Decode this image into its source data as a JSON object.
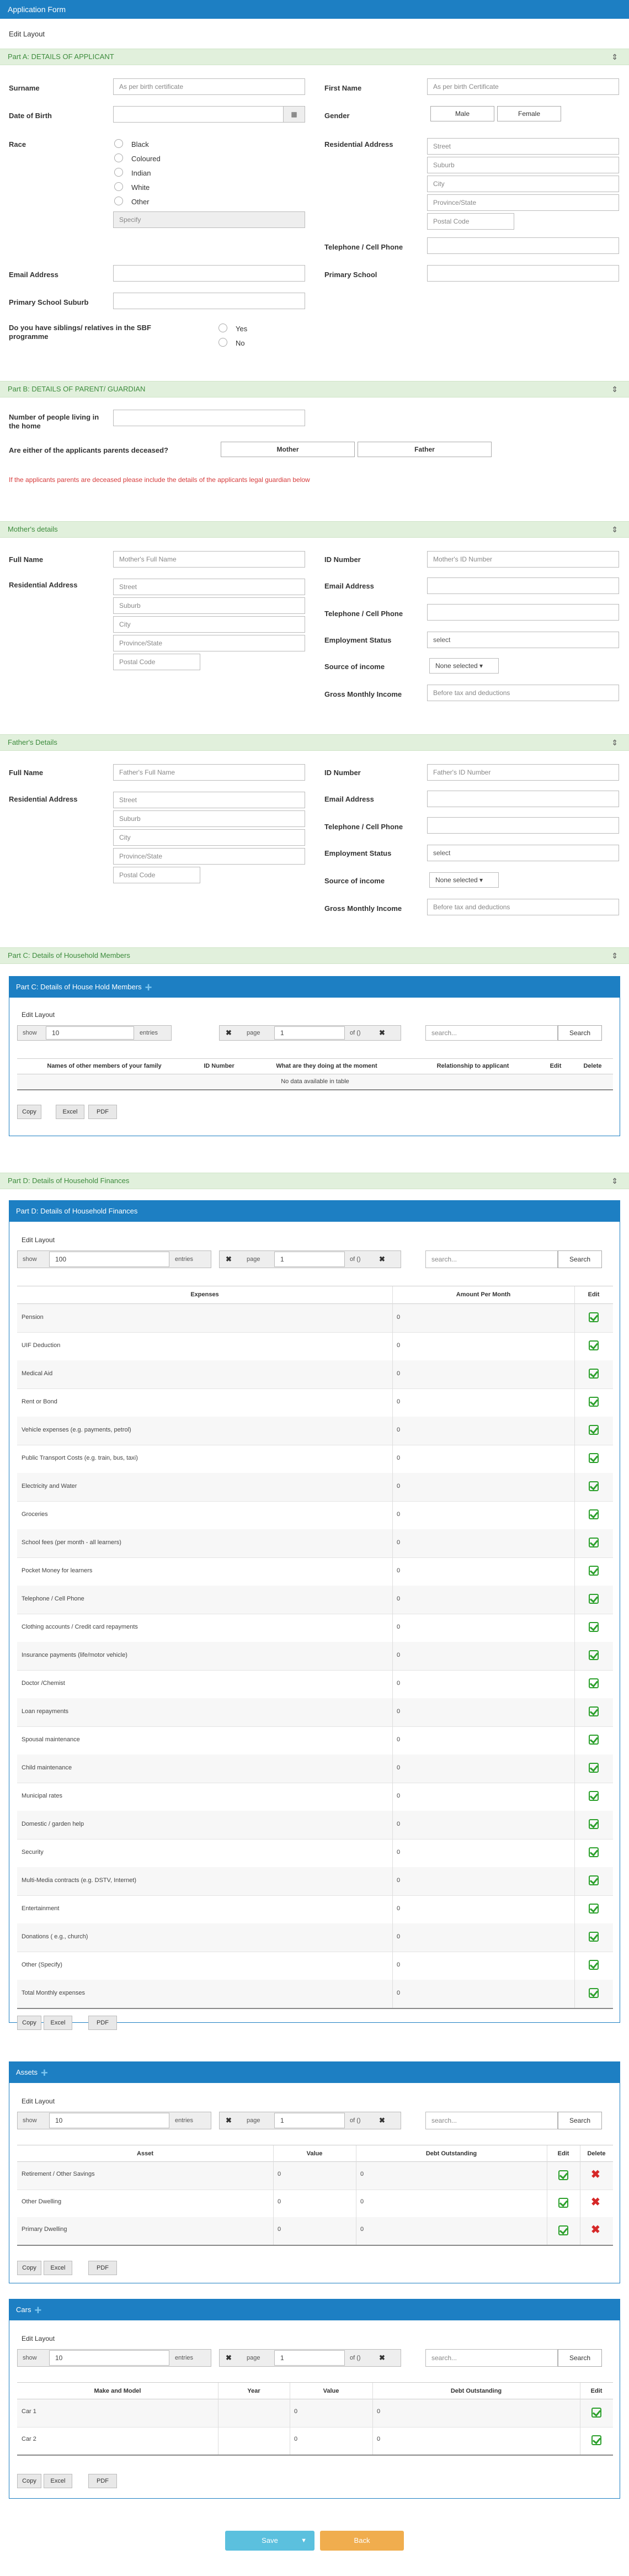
{
  "header": {
    "title": "Application Form",
    "edit_layout": "Edit Layout"
  },
  "partA": {
    "title": "Part A: DETAILS OF APPLICANT",
    "surname_label": "Surname",
    "surname_ph": "As per birth certificate",
    "first_name_label": "First Name",
    "first_name_ph": "As per birth Certificate",
    "dob_label": "Date of Birth",
    "gender_label": "Gender",
    "male": "Male",
    "female": "Female",
    "race_label": "Race",
    "races": [
      "Black",
      "Coloured",
      "Indian",
      "White",
      "Other"
    ],
    "specify_ph": "Specify",
    "res_label": "Residential Address",
    "street": "Street",
    "suburb": "Suburb",
    "city": "City",
    "province": "Province/State",
    "postal": "Postal Code",
    "tel_label": "Telephone / Cell Phone",
    "school_label": "Primary School",
    "email_label": "Email Address",
    "school_suburb_label": "Primary School Suburb",
    "siblings_label": "Do you have siblings/ relatives in the SBF programme",
    "yes": "Yes",
    "no": "No"
  },
  "partB": {
    "title": "Part B: DETAILS OF PARENT/ GUARDIAN",
    "people_label": "Number of people living in the home",
    "deceased_label": "Are either of the applicants parents deceased?",
    "mother": "Mother",
    "father": "Father",
    "note": "If the applicants parents are deceased please include the details of the applicants legal guardian below"
  },
  "mother": {
    "title": "Mother's details",
    "fullname_label": "Full Name",
    "fullname_ph": "Mother's Full Name",
    "id_label": "ID Number",
    "id_ph": "Mother's ID Number",
    "res_label": "Residential Address",
    "email_label": "Email Address",
    "tel_label": "Telephone / Cell Phone",
    "emp_label": "Employment Status",
    "emp_val": "select",
    "income_label": "Source of income",
    "income_val": "None selected ▾",
    "gross_label": "Gross Monthly Income",
    "gross_ph": "Before tax and deductions"
  },
  "father": {
    "title": "Father's Details",
    "fullname_label": "Full Name",
    "fullname_ph": "Father's Full Name",
    "id_label": "ID Number",
    "id_ph": "Father's ID Number",
    "res_label": "Residential Address",
    "email_label": "Email Address",
    "tel_label": "Telephone / Cell Phone",
    "emp_label": "Employment Status",
    "emp_val": "select",
    "income_label": "Source of income",
    "income_val": "None selected ▾",
    "gross_label": "Gross Monthly Income",
    "gross_ph": "Before tax and deductions"
  },
  "partC": {
    "title": "Part C: Details of Household Members",
    "card_title": "Part C: Details of House Hold Members",
    "edit_layout": "Edit Layout",
    "show": "show",
    "show_val": "10",
    "entries": "entries",
    "page": "page",
    "page_val": "1",
    "of": "of ()",
    "search_ph": "search...",
    "search_btn": "Search",
    "columns": [
      "Names of other members of your family",
      "ID Number",
      "What are they doing at the moment",
      "Relationship to applicant",
      "Edit",
      "Delete"
    ],
    "empty": "No data available in table",
    "copy": "Copy",
    "excel": "Excel",
    "pdf": "PDF"
  },
  "partD": {
    "title": "Part D: Details of Household Finances",
    "card_title": "Part D: Details of Household Finances",
    "edit_layout": "Edit Layout",
    "show": "show",
    "show_val": "100",
    "entries": "entries",
    "page": "page",
    "page_val": "1",
    "of": "of ()",
    "search_ph": "search...",
    "search_btn": "Search",
    "columns": [
      "Expenses",
      "Amount Per Month",
      "Edit"
    ],
    "rows": [
      [
        "Pension",
        "0"
      ],
      [
        "UIF Deduction",
        "0"
      ],
      [
        "Medical Aid",
        "0"
      ],
      [
        "Rent or Bond",
        "0"
      ],
      [
        "Vehicle expenses (e.g. payments, petrol)",
        "0"
      ],
      [
        "Public Transport Costs (e.g. train, bus, taxi)",
        "0"
      ],
      [
        "Electricity and Water",
        "0"
      ],
      [
        "Groceries",
        "0"
      ],
      [
        "School fees (per month - all learners)",
        "0"
      ],
      [
        "Pocket Money for learners",
        "0"
      ],
      [
        "Telephone / Cell Phone",
        "0"
      ],
      [
        "Clothing accounts / Credit card repayments",
        "0"
      ],
      [
        "Insurance payments (life/motor vehicle)",
        "0"
      ],
      [
        "Doctor /Chemist",
        "0"
      ],
      [
        "Loan repayments",
        "0"
      ],
      [
        "Spousal maintenance",
        "0"
      ],
      [
        "Child maintenance",
        "0"
      ],
      [
        "Municipal rates",
        "0"
      ],
      [
        "Domestic / garden help",
        "0"
      ],
      [
        "Security",
        "0"
      ],
      [
        "Multi-Media contracts (e.g. DSTV, Internet)",
        "0"
      ],
      [
        "Entertainment",
        "0"
      ],
      [
        "Donations ( e.g., church)",
        "0"
      ],
      [
        "Other (Specify)",
        "0"
      ],
      [
        "Total Monthly expenses",
        "0"
      ]
    ],
    "copy": "Copy",
    "excel": "Excel",
    "pdf": "PDF"
  },
  "assets": {
    "card_title": "Assets",
    "edit_layout": "Edit Layout",
    "show": "show",
    "show_val": "10",
    "entries": "entries",
    "page": "page",
    "page_val": "1",
    "of": "of ()",
    "search_ph": "search...",
    "search_btn": "Search",
    "columns": [
      "Asset",
      "Value",
      "Debt Outstanding",
      "Edit",
      "Delete"
    ],
    "rows": [
      [
        "Retirement / Other Savings",
        "0",
        "0"
      ],
      [
        "Other Dwelling",
        "0",
        "0"
      ],
      [
        "Primary Dwelling",
        "0",
        "0"
      ]
    ],
    "copy": "Copy",
    "excel": "Excel",
    "pdf": "PDF"
  },
  "cars": {
    "card_title": "Cars",
    "edit_layout": "Edit Layout",
    "show": "show",
    "show_val": "10",
    "entries": "entries",
    "page": "page",
    "page_val": "1",
    "of": "of ()",
    "search_ph": "search...",
    "search_btn": "Search",
    "columns": [
      "Make and Model",
      "Year",
      "Value",
      "Debt Outstanding",
      "Edit"
    ],
    "rows": [
      [
        "Car 1",
        "",
        "0",
        "0"
      ],
      [
        "Car 2",
        "",
        "0",
        "0"
      ]
    ],
    "copy": "Copy",
    "excel": "Excel",
    "pdf": "PDF"
  },
  "footer": {
    "save": "Save",
    "back": "Back"
  },
  "colors": {
    "primary": "#1d7fc3",
    "section_bg": "#e1f0dc",
    "save": "#5bc0de",
    "back": "#f0ad4e",
    "edit_green": "#2ca02c",
    "delete_red": "#d62828"
  }
}
